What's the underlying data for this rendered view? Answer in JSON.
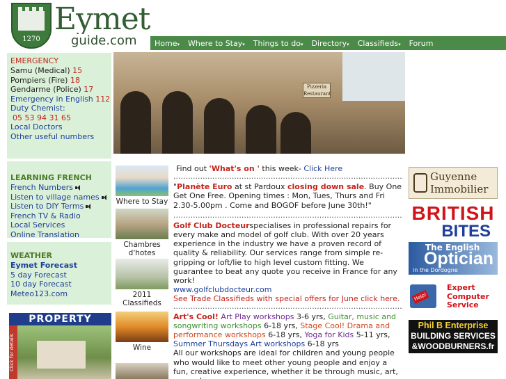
{
  "header": {
    "logo_year": "1270",
    "logo_title": "Eymet",
    "logo_sub": "guide.com",
    "nav": [
      "Home",
      "Where to Stay",
      "Things to do",
      "Directory",
      "Classifieds",
      "Forum"
    ]
  },
  "emergency": {
    "heading": "EMERGENCY",
    "items": [
      {
        "label": "Samu (Medical)",
        "num": "15"
      },
      {
        "label": "Pompiers (Fire)",
        "num": "18"
      },
      {
        "label": "Gendarme (Police)",
        "num": "17"
      },
      {
        "label": "Emergency in English",
        "num": "112"
      }
    ],
    "chemist_label": "Duty Chemist:",
    "chemist_num": "05 53 94 31 65",
    "links": [
      "Local Doctors",
      "Other useful numbers"
    ]
  },
  "learning": {
    "heading": "LEARNING FRENCH",
    "items": [
      "French Numbers",
      "Listen to village names",
      "Listen to DIY Terms",
      "French TV & Radio",
      "Local Services",
      "Online Translation"
    ]
  },
  "weather": {
    "heading": "WEATHER",
    "items": [
      "Eymet Forecast",
      "5 day Forecast",
      "10 day Forecast",
      "Meteo123.com"
    ]
  },
  "property": {
    "title": "PROPERTY",
    "side": "Click for details"
  },
  "hero": {
    "sign": "Pizzeria Restaurant"
  },
  "thumbs": [
    {
      "label": "Where to Stay"
    },
    {
      "label": "Chambres d'hotes"
    },
    {
      "label": "2011 Classifieds"
    },
    {
      "label": "Wine"
    }
  ],
  "main": {
    "intro_pre": "Find out ",
    "intro_bold": "'What's on '",
    "intro_mid": " this week- ",
    "intro_link": "Click Here",
    "dots": "......................................................................................................................................",
    "planete_bold": "Planète Euro",
    "planete_mid": " at st Pardoux ",
    "planete_sale": "closing down sale",
    "planete_rest": ". Buy One Get One Free. Opening times : Mon, Tues, Thurs and Fri 2.30-5.00pm . Come and BOGOF before June 30th!\"",
    "golf_bold": "Golf Club Docteur",
    "golf_text": "specialises in professional repairs for every make and model of golf club. With over 20 years experience in the industry we have a proven record of quality & reliability. Our services range from simple re-gripping or loft/lie to high level custom fitting. We guarantee to beat any quote you receive in France for any work!",
    "golf_url": "www.golfclubdocteur.com",
    "golf_trade": "See Trade Classifieds with special offers for June click here.",
    "arts_bold": "Art's Cool!",
    "arts_1": " Art Play workshops",
    "arts_1a": " 3-6 yrs, ",
    "arts_2": "Guitar, music and songwriting workshops",
    "arts_2a": " 6-18 yrs, ",
    "arts_3": "Stage Cool! Drama and performance workshops",
    "arts_3a": " 6-18 yrs, ",
    "arts_4": "Yoga for Kids",
    "arts_4a": " 5-11 yrs, ",
    "arts_5": "Summer Thursdays Art workshops",
    "arts_5a": " 6-18 yrs",
    "arts_body": "All our workshops are ideal for children and young people who would like to meet other young people and enjoy a fun, creative experience, whether it be through music, art, yoga, drama or"
  },
  "ads": {
    "guyenne": [
      "Guyenne",
      "Immobilier"
    ],
    "british": [
      "BRITISH",
      "BITES"
    ],
    "optician": [
      "The English",
      "Optician",
      "in the Dordogne"
    ],
    "expert": [
      "Expert",
      "Computer",
      "Service"
    ],
    "expert_help": "Help!",
    "phil": [
      "Phil B  Enterprise",
      "BUILDING SERVICES",
      "&WOODBURNERS.fr"
    ]
  }
}
